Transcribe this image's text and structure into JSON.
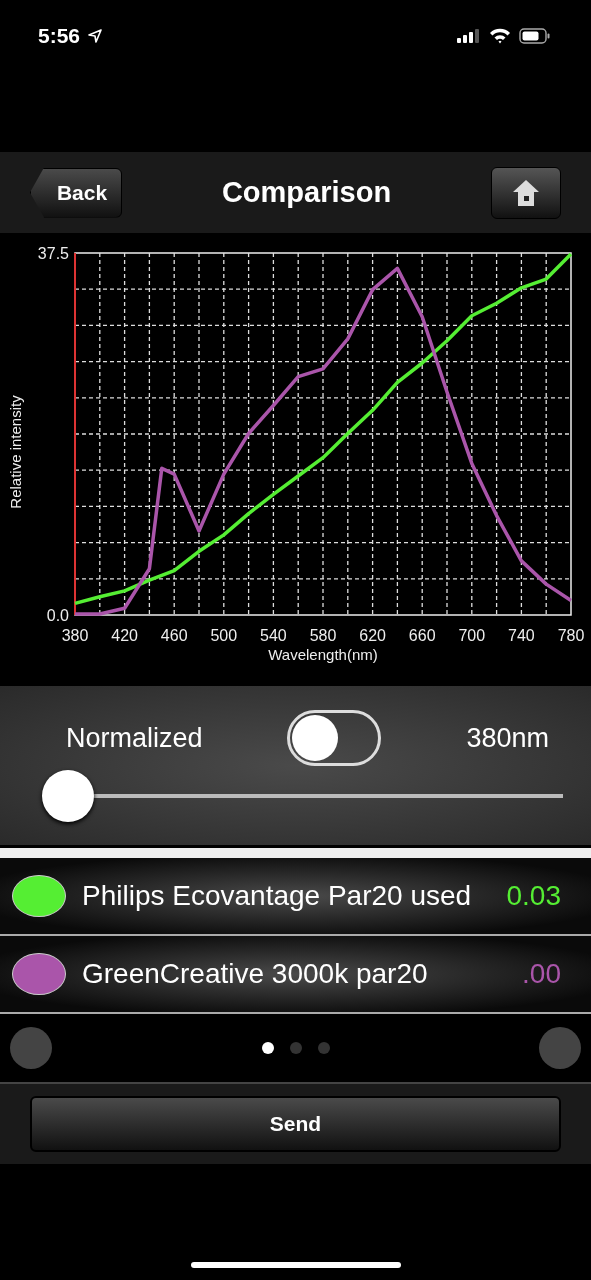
{
  "status_bar": {
    "time": "5:56"
  },
  "nav": {
    "back": "Back",
    "title": "Comparison"
  },
  "chart": {
    "chart_data": {
      "type": "line",
      "xlabel": "Wavelength(nm)",
      "ylabel": "Relative intensity",
      "x": [
        380,
        400,
        420,
        440,
        450,
        460,
        480,
        500,
        520,
        540,
        560,
        580,
        600,
        620,
        640,
        660,
        680,
        700,
        720,
        740,
        760,
        780
      ],
      "series": [
        {
          "color": "#55ee33",
          "values": [
            1.2,
            1.9,
            2.5,
            3.6,
            4.1,
            4.6,
            6.6,
            8.3,
            10.5,
            12.5,
            14.4,
            16.3,
            18.8,
            21.2,
            24.1,
            26.1,
            28.4,
            31.0,
            32.3,
            33.9,
            34.8,
            37.4
          ]
        },
        {
          "color": "#aa55aa",
          "values": [
            0.1,
            0.1,
            0.7,
            4.8,
            15.2,
            14.6,
            8.7,
            14.6,
            18.8,
            21.7,
            24.7,
            25.5,
            28.6,
            33.7,
            35.9,
            30.9,
            23.1,
            15.7,
            10.3,
            5.6,
            3.2,
            1.5
          ]
        }
      ],
      "grid": true,
      "xlim": [
        380,
        780
      ],
      "ylim": [
        0,
        37.5
      ],
      "xticks": [
        380,
        420,
        460,
        500,
        540,
        580,
        620,
        660,
        700,
        740,
        780
      ],
      "yticks": [
        {
          "value": 0,
          "label": "0.0"
        },
        {
          "value": 37.5,
          "label": "37.5"
        }
      ]
    }
  },
  "controls": {
    "normalized_label": "Normalized",
    "normalized_on": false,
    "reading": "380nm",
    "level": 0
  },
  "lamps": [
    {
      "name": "Philips Ecovantage Par20 used",
      "value": "0.03",
      "color": "#55ee33"
    },
    {
      "name": "GreenCreative 3000k par20",
      "value": ".00",
      "color": "#aa55aa"
    }
  ],
  "pager": [
    {
      "selected": true
    },
    {
      "selected": false
    },
    {
      "selected": false
    }
  ],
  "send_button": "Send"
}
